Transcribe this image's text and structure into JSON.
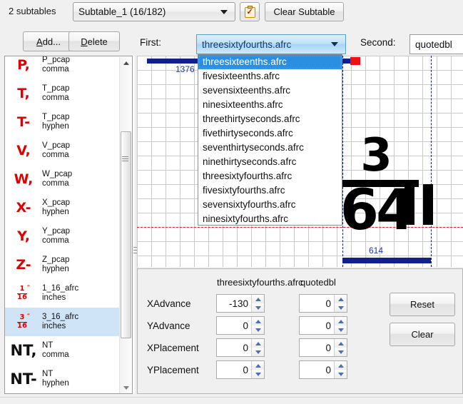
{
  "toolbar": {
    "subtable_count": "2 subtables",
    "subtable_selected": "Subtable_1 (16/182)",
    "clipboard_icon": "clipboard-check-icon",
    "clipboard_check": "✓",
    "clear_subtable_label": "Clear Subtable"
  },
  "controls": {
    "add_label_pre": "A",
    "add_label_post": "dd...",
    "delete_label_pre": "D",
    "delete_label_post": "elete",
    "first_label": "First:",
    "first_value": "threesixtyfourths.afrc",
    "second_label": "Second:",
    "second_value": "quotedbl"
  },
  "dropdown": {
    "open": true,
    "items": [
      "threesixteenths.afrc",
      "fivesixteenths.afrc",
      "sevensixteenths.afrc",
      "ninesixteenths.afrc",
      "threethirtyseconds.afrc",
      "fivethirtyseconds.afrc",
      "seventhirtyseconds.afrc",
      "ninethirtyseconds.afrc",
      "threesixtyfourths.afrc",
      "fivesixtyfourths.afrc",
      "sevensixtyfourths.afrc",
      "ninesixtyfourths.afrc"
    ],
    "selected_index": 0
  },
  "glyph_list": {
    "items": [
      {
        "icon": "P,",
        "icon_kind": "red",
        "line1": "P_pcap",
        "line2": "comma",
        "selected": false
      },
      {
        "icon": "T,",
        "icon_kind": "red",
        "line1": "T_pcap",
        "line2": "comma",
        "selected": false
      },
      {
        "icon": "T-",
        "icon_kind": "red",
        "line1": "T_pcap",
        "line2": "hyphen",
        "selected": false
      },
      {
        "icon": "V,",
        "icon_kind": "red",
        "line1": "V_pcap",
        "line2": "comma",
        "selected": false
      },
      {
        "icon": "W,",
        "icon_kind": "red",
        "line1": "W_pcap",
        "line2": "comma",
        "selected": false
      },
      {
        "icon": "X-",
        "icon_kind": "red",
        "line1": "X_pcap",
        "line2": "hyphen",
        "selected": false
      },
      {
        "icon": "Y,",
        "icon_kind": "red",
        "line1": "Y_pcap",
        "line2": "comma",
        "selected": false
      },
      {
        "icon": "Z-",
        "icon_kind": "red",
        "line1": "Z_pcap",
        "line2": "hyphen",
        "selected": false
      },
      {
        "icon": "frac:1:16",
        "icon_kind": "red",
        "line1": "1_16_afrc",
        "line2": "inches",
        "selected": false
      },
      {
        "icon": "frac:3:16",
        "icon_kind": "red",
        "line1": "3_16_afrc",
        "line2": "inches",
        "selected": true
      },
      {
        "icon": "NT,",
        "icon_kind": "black",
        "line1": "NT",
        "line2": "comma",
        "selected": false
      },
      {
        "icon": "NT-",
        "icon_kind": "black",
        "line1": "NT",
        "line2": "hyphen",
        "selected": false
      }
    ]
  },
  "preview": {
    "advance_top_label": "1376",
    "advance_bottom_label": "614",
    "glyph_numerator": "3",
    "glyph_denominator": "64",
    "second_glyph": "quotedbl",
    "baseline_color": "#e02020",
    "advance_bar_color": "#11218c",
    "marker_color": "#ee1111"
  },
  "bottom_panel": {
    "col1_title": "threesixtyfourths.afrc",
    "col2_title": "quotedbl",
    "rows": [
      {
        "label": "XAdvance",
        "v1": "-130",
        "v2": "0"
      },
      {
        "label": "YAdvance",
        "v1": "0",
        "v2": "0"
      },
      {
        "label": "XPlacement",
        "v1": "0",
        "v2": "0"
      },
      {
        "label": "YPlacement",
        "v1": "0",
        "v2": "0"
      }
    ],
    "reset_label": "Reset",
    "clear_label": "Clear"
  }
}
